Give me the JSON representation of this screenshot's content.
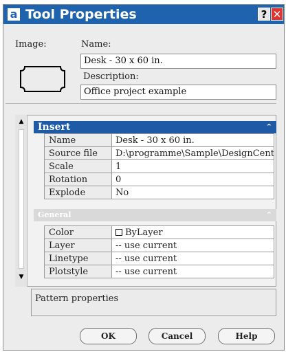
{
  "window": {
    "app_icon": "a",
    "title": "Tool Properties",
    "help_glyph": "?",
    "close_glyph": "✕"
  },
  "form": {
    "image_label": "Image:",
    "name_label": "Name:",
    "name_value": "Desk - 30 x 60 in.",
    "description_label": "Description:",
    "description_value": "Office project example"
  },
  "panel": {
    "scroll_up_glyph": "▲",
    "scroll_down_glyph": "▼",
    "insert": {
      "title": "Insert",
      "collapse_glyph": "⌃",
      "rows": [
        {
          "key": "Name",
          "value": "Desk - 30 x 60 in."
        },
        {
          "key": "Source file",
          "value": "D:\\programme\\Sample\\DesignCenter\\..."
        },
        {
          "key": "Scale",
          "value": "1"
        },
        {
          "key": "Rotation",
          "value": "0"
        },
        {
          "key": "Explode",
          "value": "No"
        }
      ]
    },
    "general": {
      "title": "General",
      "collapse_glyph": "⌃",
      "rows": [
        {
          "key": "Color",
          "value": "ByLayer"
        },
        {
          "key": "Layer",
          "value": "-- use current"
        },
        {
          "key": "Linetype",
          "value": "-- use current"
        },
        {
          "key": "Plotstyle",
          "value": "-- use current"
        }
      ]
    }
  },
  "description_box": "Pattern properties",
  "buttons": {
    "ok": "OK",
    "cancel": "Cancel",
    "help": "Help"
  },
  "colors": {
    "titlebar": "#1f63ae",
    "insert_header": "#1f5aa6",
    "general_header": "#d9d9d9",
    "close": "#e03333"
  }
}
